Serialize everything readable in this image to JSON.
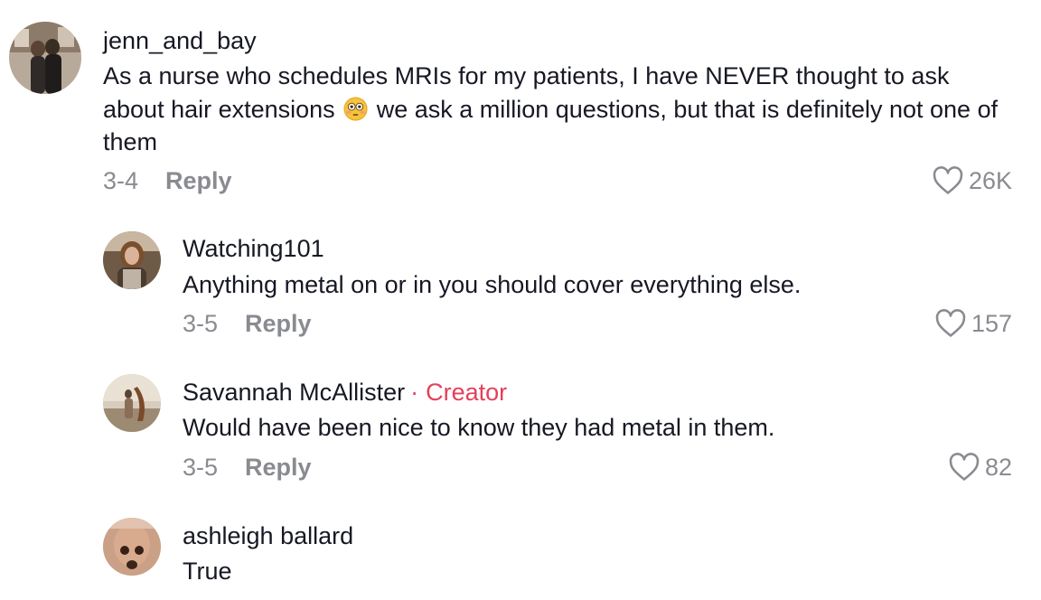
{
  "comments": [
    {
      "username": "jenn_and_bay",
      "text_before": "As a nurse who schedules MRIs for my patients, I have NEVER thought to ask about hair extensions",
      "emoji": "flushed-face-emoji",
      "text_after": " we ask a million questions, but that is definitely not one of them",
      "date": "3-4",
      "reply_label": "Reply",
      "likes": "26K"
    },
    {
      "username": "Watching101",
      "text": "Anything metal on or in you should cover everything else.",
      "date": "3-5",
      "reply_label": "Reply",
      "likes": "157"
    },
    {
      "username": "Savannah McAllister",
      "separator": "·",
      "creator_label": "Creator",
      "text": "Would have been nice to know they had metal in them.",
      "date": "3-5",
      "reply_label": "Reply",
      "likes": "82"
    },
    {
      "username": "ashleigh ballard",
      "text": "True"
    }
  ],
  "colors": {
    "text_primary": "#161823",
    "text_secondary": "#8a8b91",
    "creator_accent": "#e4405a"
  }
}
